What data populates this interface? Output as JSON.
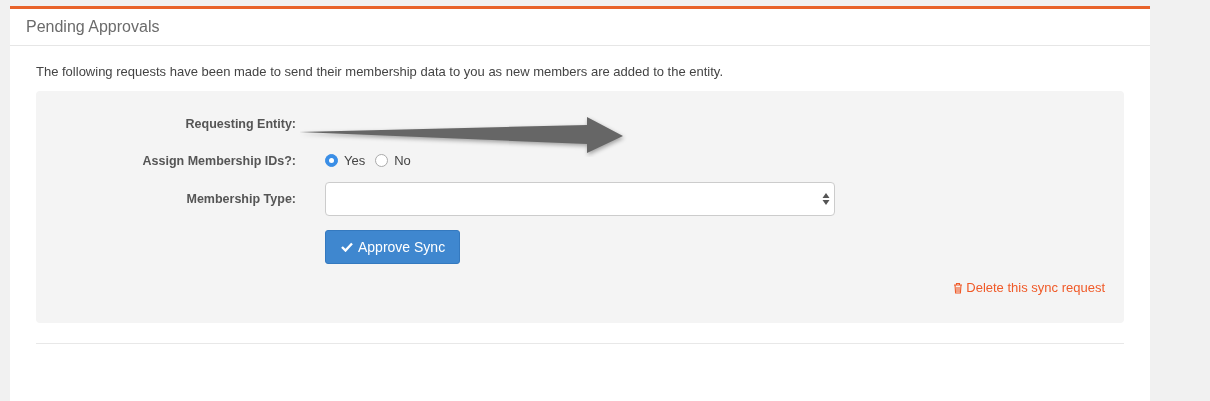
{
  "panel": {
    "title": "Pending Approvals"
  },
  "intro": "The following requests have been made to send their membership data to you as new members are added to the entity.",
  "request": {
    "fields": [
      {
        "kind": "text",
        "label": "Requesting Entity:"
      },
      {
        "kind": "radio",
        "label": "Assign Membership IDs?:",
        "options": [
          {
            "label": "Yes",
            "selected": true
          },
          {
            "label": "No",
            "selected": false
          }
        ]
      },
      {
        "kind": "select",
        "label": "Membership Type:"
      }
    ],
    "approve_button": "Approve Sync",
    "delete_link": "Delete this sync request"
  }
}
